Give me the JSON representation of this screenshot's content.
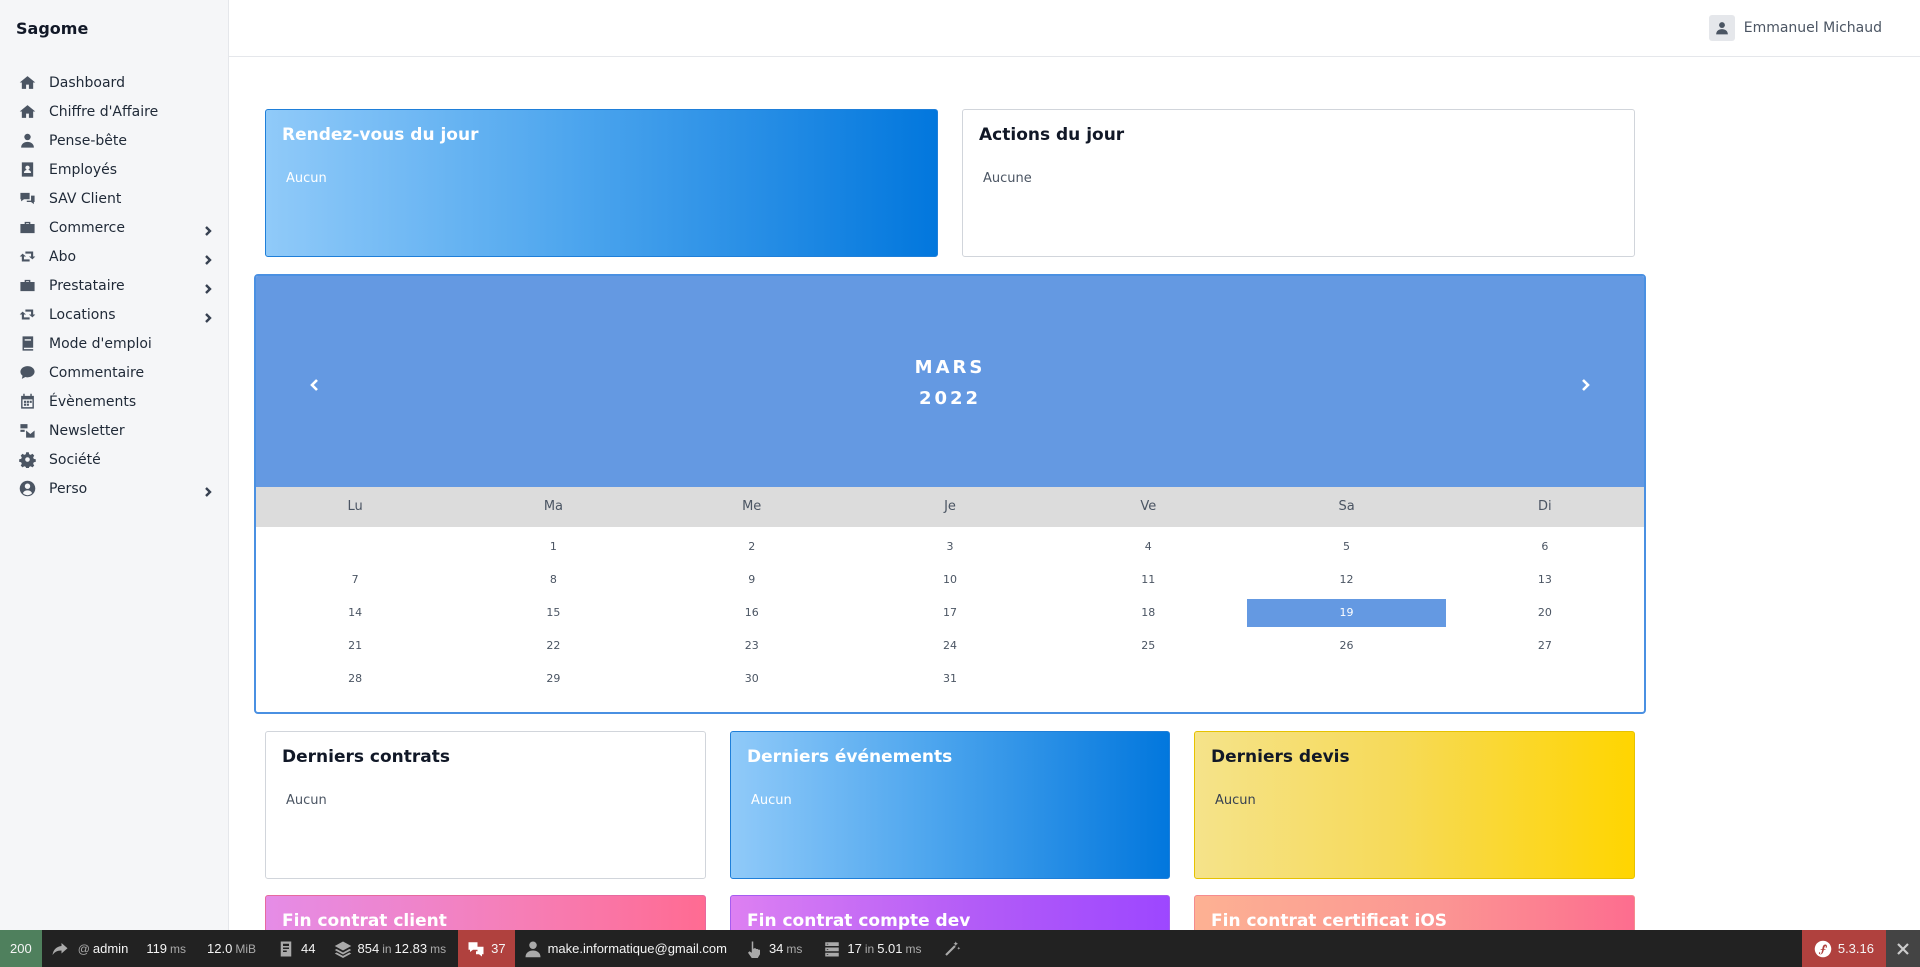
{
  "app": {
    "brand": "Sagome"
  },
  "sidebar": {
    "items": [
      {
        "label": "Dashboard",
        "icon": "home-icon",
        "has_submenu": false
      },
      {
        "label": "Chiffre d'Affaire",
        "icon": "home-icon",
        "has_submenu": false
      },
      {
        "label": "Pense-bête",
        "icon": "user-icon",
        "has_submenu": false
      },
      {
        "label": "Employés",
        "icon": "id-card-icon",
        "has_submenu": false
      },
      {
        "label": "SAV Client",
        "icon": "chat-bubbles-icon",
        "has_submenu": false
      },
      {
        "label": "Commerce",
        "icon": "briefcase-icon",
        "has_submenu": true
      },
      {
        "label": "Abo",
        "icon": "retweet-icon",
        "has_submenu": true
      },
      {
        "label": "Prestataire",
        "icon": "briefcase-icon",
        "has_submenu": true
      },
      {
        "label": "Locations",
        "icon": "retweet-icon",
        "has_submenu": true
      },
      {
        "label": "Mode d'emploi",
        "icon": "book-icon",
        "has_submenu": false
      },
      {
        "label": "Commentaire",
        "icon": "comment-icon",
        "has_submenu": false
      },
      {
        "label": "Évènements",
        "icon": "calendar-icon",
        "has_submenu": false
      },
      {
        "label": "Newsletter",
        "icon": "mail-bulk-icon",
        "has_submenu": false
      },
      {
        "label": "Société",
        "icon": "gear-icon",
        "has_submenu": false
      },
      {
        "label": "Perso",
        "icon": "user-circle-icon",
        "has_submenu": true
      }
    ]
  },
  "header": {
    "user_name": "Emmanuel Michaud"
  },
  "cards": {
    "rdv": {
      "title": "Rendez-vous du jour",
      "body": "Aucun"
    },
    "actions": {
      "title": "Actions du jour",
      "body": "Aucune"
    },
    "contrats": {
      "title": "Derniers contrats",
      "body": "Aucun"
    },
    "evenements": {
      "title": "Derniers événements",
      "body": "Aucun"
    },
    "devis": {
      "title": "Derniers devis",
      "body": "Aucun"
    },
    "fin_client": {
      "title": "Fin contrat client"
    },
    "fin_dev": {
      "title": "Fin contrat compte dev"
    },
    "fin_ios": {
      "title": "Fin contrat certificat iOS"
    }
  },
  "calendar": {
    "month": "MARS",
    "year": "2022",
    "weekdays": [
      "Lu",
      "Ma",
      "Me",
      "Je",
      "Ve",
      "Sa",
      "Di"
    ],
    "weeks": [
      [
        "",
        "1",
        "2",
        "3",
        "4",
        "5",
        "6"
      ],
      [
        "7",
        "8",
        "9",
        "10",
        "11",
        "12",
        "13"
      ],
      [
        "14",
        "15",
        "16",
        "17",
        "18",
        "19",
        "20"
      ],
      [
        "21",
        "22",
        "23",
        "24",
        "25",
        "26",
        "27"
      ],
      [
        "28",
        "29",
        "30",
        "31",
        "",
        "",
        ""
      ]
    ],
    "today": "19",
    "accent_color": "#6499e2"
  },
  "debug_toolbar": {
    "status_code": "200",
    "route_prefix": "@",
    "route": "admin",
    "time_value": "119",
    "time_unit": "ms",
    "memory_value": "12.0",
    "memory_unit": "MiB",
    "forms_count": "44",
    "twig_count": "854",
    "twig_in": "in",
    "twig_time": "12.83",
    "twig_unit": "ms",
    "translation_count": "37",
    "user_email": "make.informatique@gmail.com",
    "events_time": "34",
    "events_unit": "ms",
    "db_count": "17",
    "db_in": "in",
    "db_time": "5.01",
    "db_unit": "ms",
    "version": "5.3.16"
  }
}
